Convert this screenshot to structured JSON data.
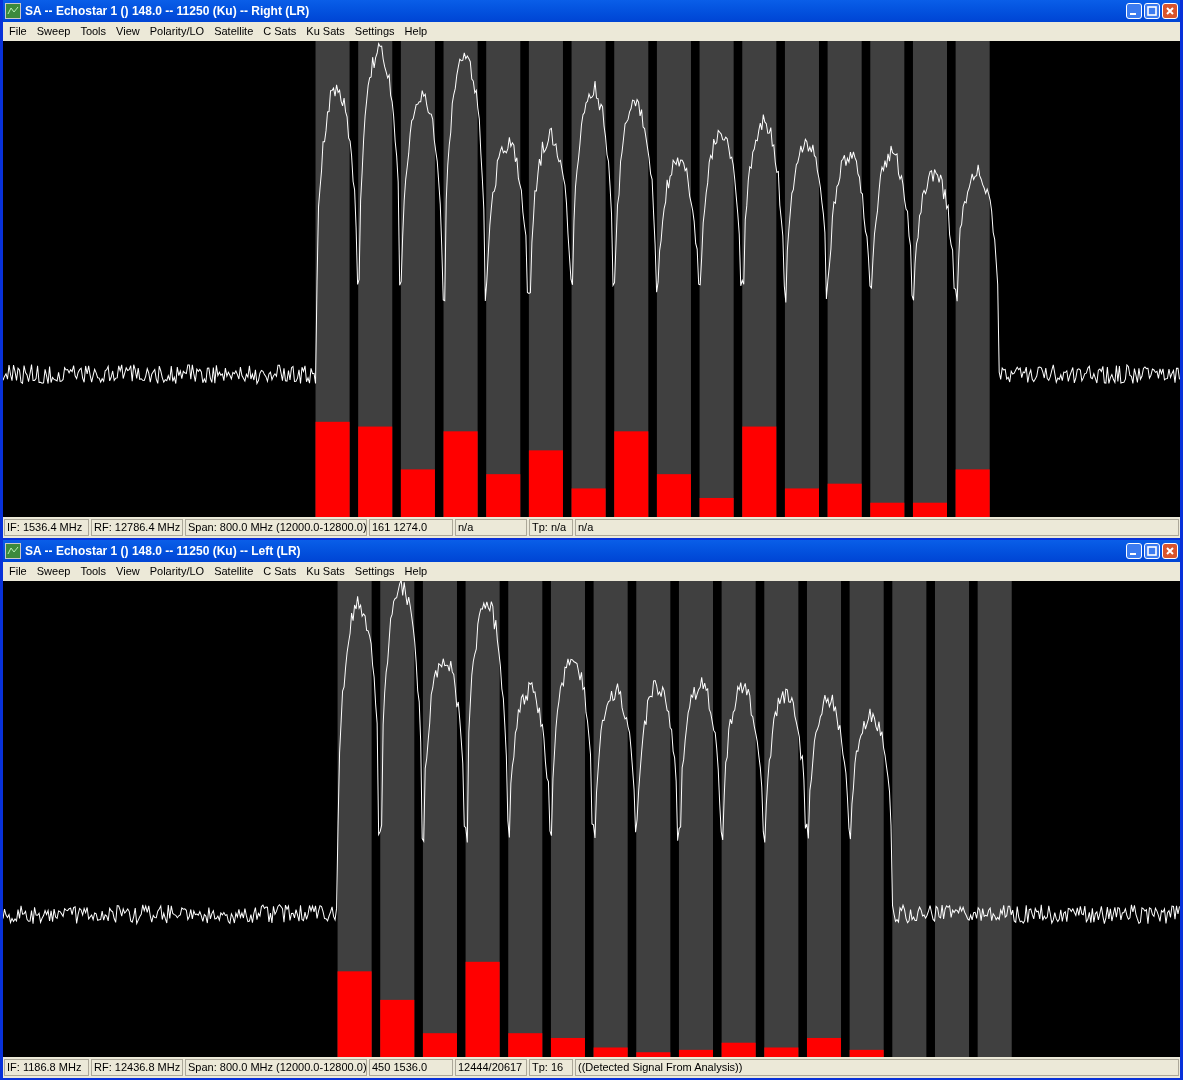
{
  "windows": [
    {
      "title": "SA -- Echostar 1 () 148.0 -- 11250 (Ku) -- Right (LR)",
      "active": true,
      "menu": [
        "File",
        "Sweep",
        "Tools",
        "View",
        "Polarity/LO",
        "Satellite",
        "C Sats",
        "Ku Sats",
        "Settings",
        "Help"
      ],
      "bands": [
        {
          "kind": "signal",
          "level": 0.2
        },
        {
          "kind": "signal",
          "level": 0.19
        },
        {
          "kind": "signal",
          "level": 0.1
        },
        {
          "kind": "signal",
          "level": 0.18
        },
        {
          "kind": "signal",
          "level": 0.09
        },
        {
          "kind": "signal",
          "level": 0.14
        },
        {
          "kind": "signal",
          "level": 0.06
        },
        {
          "kind": "signal",
          "level": 0.18
        },
        {
          "kind": "signal",
          "level": 0.09
        },
        {
          "kind": "signal",
          "level": 0.04
        },
        {
          "kind": "signal",
          "level": 0.19
        },
        {
          "kind": "signal",
          "level": 0.06
        },
        {
          "kind": "signal",
          "level": 0.07
        },
        {
          "kind": "signal",
          "level": 0.03
        },
        {
          "kind": "signal",
          "level": 0.03
        },
        {
          "kind": "signal",
          "level": 0.1
        }
      ],
      "status_bar": [
        "IF: 1536.4 MHz",
        "RF: 12786.4 MHz",
        "Span: 800.0 MHz (12000.0-12800.0)",
        "161 1274.0",
        "n/a",
        "Tp: n/a",
        "n/a"
      ]
    },
    {
      "title": "SA -- Echostar 1 () 148.0 -- 11250 (Ku) -- Left (LR)",
      "active": true,
      "menu": [
        "File",
        "Sweep",
        "Tools",
        "View",
        "Polarity/LO",
        "Satellite",
        "C Sats",
        "Ku Sats",
        "Settings",
        "Help"
      ],
      "bands": [
        {
          "kind": "signal",
          "level": 0.18
        },
        {
          "kind": "signal",
          "level": 0.12
        },
        {
          "kind": "signal",
          "level": 0.05
        },
        {
          "kind": "signal",
          "level": 0.2
        },
        {
          "kind": "signal",
          "level": 0.05
        },
        {
          "kind": "signal",
          "level": 0.04
        },
        {
          "kind": "signal",
          "level": 0.02
        },
        {
          "kind": "signal",
          "level": 0.01
        },
        {
          "kind": "signal",
          "level": 0.015
        },
        {
          "kind": "signal",
          "level": 0.03
        },
        {
          "kind": "signal",
          "level": 0.02
        },
        {
          "kind": "signal",
          "level": 0.04
        },
        {
          "kind": "signal",
          "level": 0.015
        },
        {
          "kind": "empty"
        },
        {
          "kind": "empty"
        },
        {
          "kind": "empty"
        }
      ],
      "status_bar": [
        "IF: 1186.8 MHz",
        "RF: 12436.8 MHz",
        "Span: 800.0 MHz (12000.0-12800.0)",
        "450 1536.0",
        "12444/20617",
        "Tp: 16",
        "((Detected Signal From Analysis))"
      ]
    }
  ]
}
